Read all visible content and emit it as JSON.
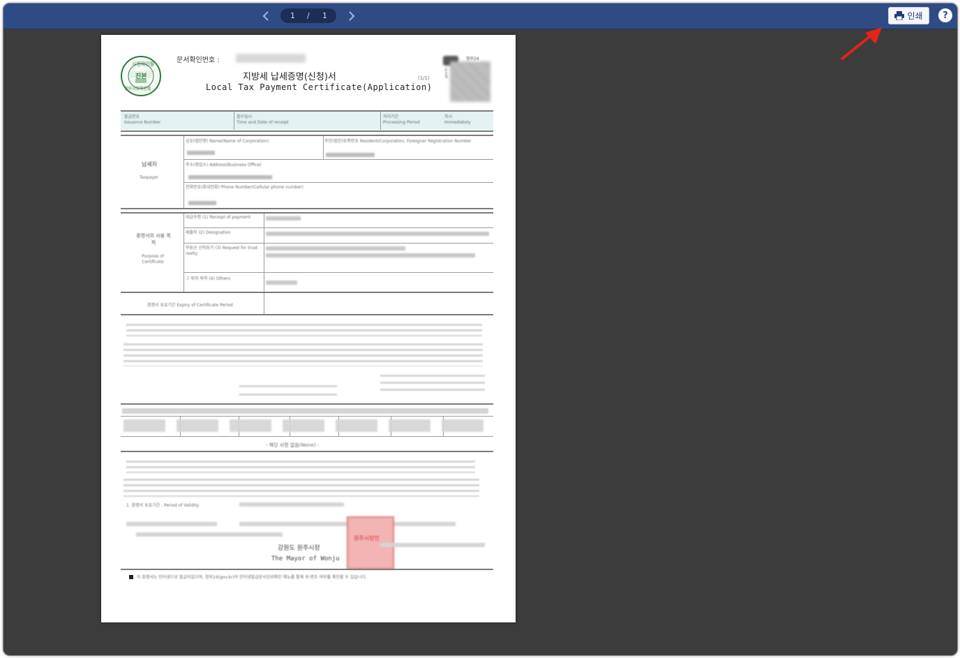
{
  "toolbar": {
    "prev_icon": "chevron-left-icon",
    "next_icon": "chevron-right-icon",
    "current_page": "1",
    "separator": "/",
    "total_pages": "1",
    "print_label": "인쇄",
    "print_icon": "printer-icon",
    "help_label": "?"
  },
  "document": {
    "doc_no_label": "문서확인번호 :",
    "title_ko": "지방세 납세증명(신청)서",
    "title_en": "Local Tax Payment Certificate(Application)",
    "page_count": "(1/1)",
    "seal_top": "시정확인필",
    "seal_mid": "진본",
    "seal_bottom": "정부시정확인필",
    "gov_mark": "정부24",
    "gov_side": "gov.kr",
    "row1": [
      "발급번호",
      "Issuance Number",
      "접수일시",
      "Time and Date of receipt",
      "처리기간",
      "Processing Period",
      "즉시",
      "Immediately"
    ],
    "taxpayer_label_ko": "납세자",
    "taxpayer_label_en": "Taxpayer",
    "taxpayer_fields": [
      "상호(법인명) Name(Name of Corporation)",
      "주민(법인)등록번호 Resident/Corporation, Foreigner Registration Number",
      "주소(영업소) Address(Business Office)",
      "전화번호(휴대전화) Phone Number(Cellular phone number)"
    ],
    "purpose_label_ko": "증명서의 사용 목적",
    "purpose_label_en": "Purpose of Certificate",
    "purpose_rows": [
      "대금수령 (1) Receipt of payment",
      "제출처 (2) Designation",
      "부동산 신탁등기 (3) Request for trust realty",
      "그 밖의 목적 (4) Others"
    ],
    "validity_label": "증명서 유효기간 Expiry of Certificate Period",
    "clause_note": "- 해당 사항 없음(None) -",
    "period_label": "1. 증명서 유효기간 : Period of Validity",
    "mayor_ko": "강원도 원주시장",
    "mayor_en": "The Mayor of Wonju",
    "stamp_text": "원주시장인",
    "footer_note": "이 증명서는 인터넷으로 발급되었으며, 정부24(gov.kr)의 인터넷발급문서진위확인 메뉴를 통해 위·변조 여부를 확인할 수 있습니다."
  },
  "colors": {
    "toolbar_bg": "#2f4b86",
    "viewer_bg": "#3c3c3c",
    "annotation_arrow": "#e3231c"
  }
}
